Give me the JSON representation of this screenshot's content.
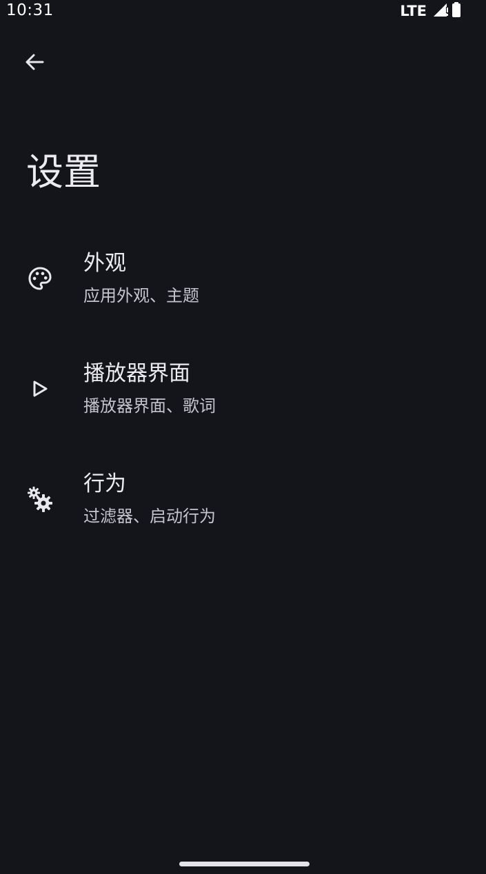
{
  "status_bar": {
    "time": "10:31",
    "network": "LTE"
  },
  "header": {
    "back_icon": "arrow-back-icon",
    "title": "设置"
  },
  "settings": {
    "items": [
      {
        "icon": "palette-icon",
        "title": "外观",
        "subtitle": "应用外观、主题"
      },
      {
        "icon": "play-outline-icon",
        "title": "播放器界面",
        "subtitle": "播放器界面、歌词"
      },
      {
        "icon": "gears-icon",
        "title": "行为",
        "subtitle": "过滤器、启动行为"
      }
    ]
  },
  "colors": {
    "background": "#14151a",
    "text_primary": "#ececf0",
    "text_secondary": "#c4c5ce"
  }
}
